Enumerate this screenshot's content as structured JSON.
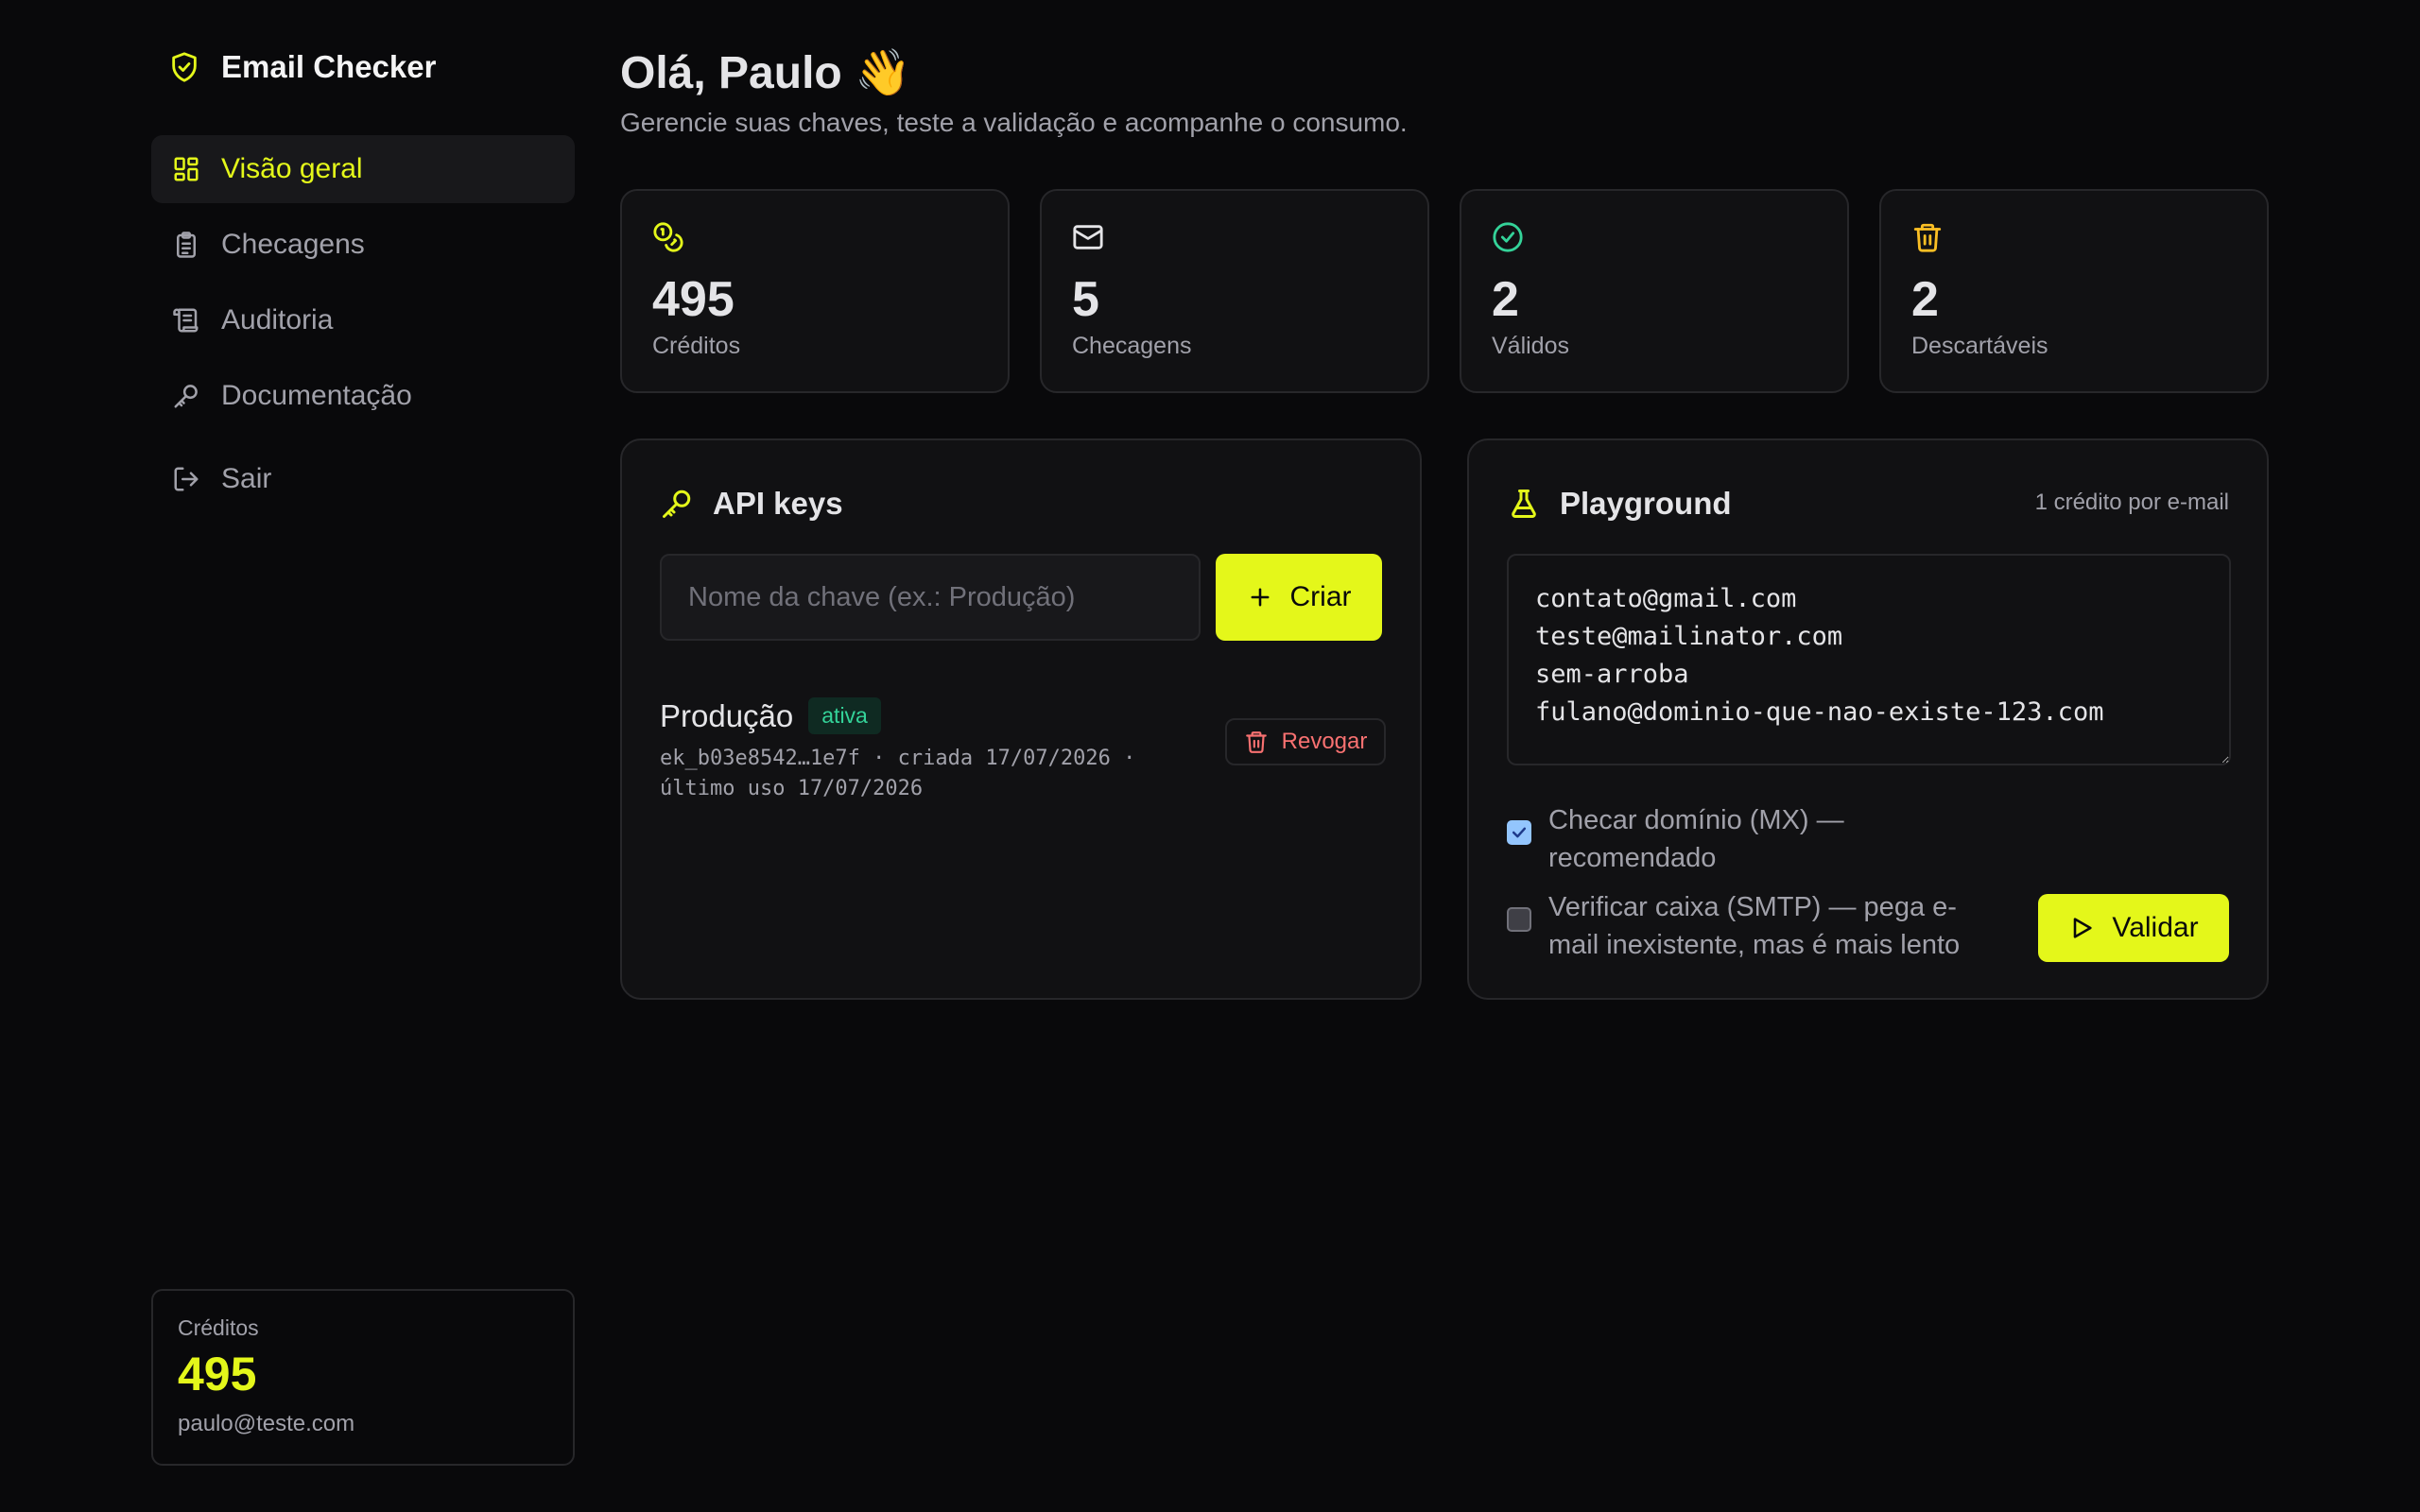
{
  "app": {
    "name": "Email Checker"
  },
  "sidebar": {
    "items": [
      {
        "label": "Visão geral"
      },
      {
        "label": "Checagens"
      },
      {
        "label": "Auditoria"
      },
      {
        "label": "Documentação"
      },
      {
        "label": "Sair"
      }
    ],
    "credits": {
      "label": "Créditos",
      "value": "495",
      "email": "paulo@teste.com"
    }
  },
  "header": {
    "greeting": "Olá, Paulo 👋",
    "subtitle": "Gerencie suas chaves, teste a validação e acompanhe o consumo."
  },
  "stats": [
    {
      "value": "495",
      "label": "Créditos",
      "icon": "coins-icon"
    },
    {
      "value": "5",
      "label": "Checagens",
      "icon": "mail-icon"
    },
    {
      "value": "2",
      "label": "Válidos",
      "icon": "check-circle-icon"
    },
    {
      "value": "2",
      "label": "Descartáveis",
      "icon": "trash-icon"
    }
  ],
  "api_keys": {
    "title": "API keys",
    "input_placeholder": "Nome da chave (ex.: Produção)",
    "create_label": "Criar",
    "keys": [
      {
        "name": "Produção",
        "status": "ativa",
        "meta": "ek_b03e8542…1e7f · criada 17/07/2026 · último uso 17/07/2026",
        "revoke_label": "Revogar"
      }
    ]
  },
  "playground": {
    "title": "Playground",
    "note": "1 crédito por e-mail",
    "emails": "contato@gmail.com\nteste@mailinator.com\nsem-arroba\nfulano@dominio-que-nao-existe-123.com",
    "options": [
      {
        "label": "Checar domínio (MX) — recomendado",
        "checked": true
      },
      {
        "label": "Verificar caixa (SMTP) — pega e-mail inexistente, mas é mais lento",
        "checked": false
      }
    ],
    "validate_label": "Validar"
  },
  "colors": {
    "accent": "#e4f71a",
    "background": "#09090b",
    "success": "#34d399",
    "danger": "#f87171"
  }
}
